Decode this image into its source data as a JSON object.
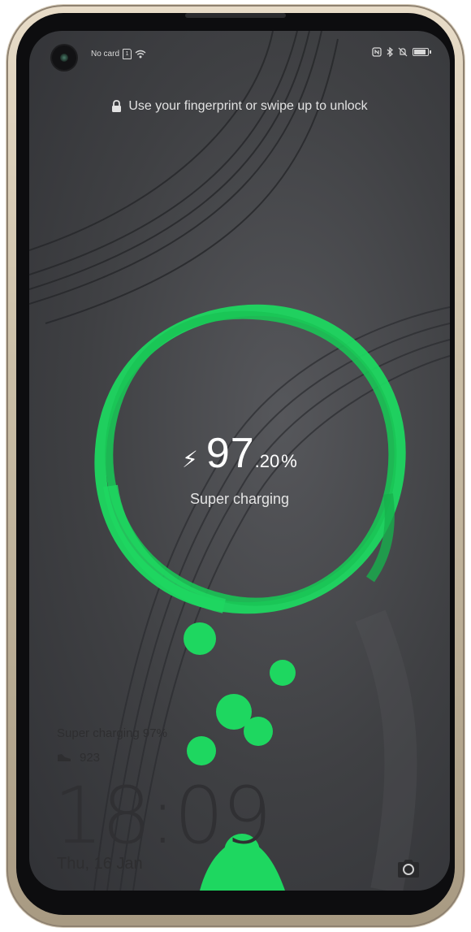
{
  "status_bar": {
    "carrier_text": "No card",
    "sim_label": "1"
  },
  "lockscreen": {
    "unlock_hint": "Use your fingerprint or swipe up to unlock"
  },
  "charging": {
    "percent_integer": "97",
    "percent_decimal": ".20",
    "percent_sign": "%",
    "status": "Super charging",
    "level": 0.972,
    "accent_color": "#1ed760"
  },
  "notifications": {
    "charging_text": "Super charging 97%",
    "steps": "923"
  },
  "clock": {
    "time": "18:09",
    "date": "Thu, 16 Jan"
  },
  "icons": [
    "lock-icon",
    "wifi-icon",
    "sim-icon",
    "nfc-icon",
    "bluetooth-icon",
    "mute-icon",
    "battery-icon",
    "bolt-icon",
    "shoe-icon",
    "camera-icon"
  ]
}
